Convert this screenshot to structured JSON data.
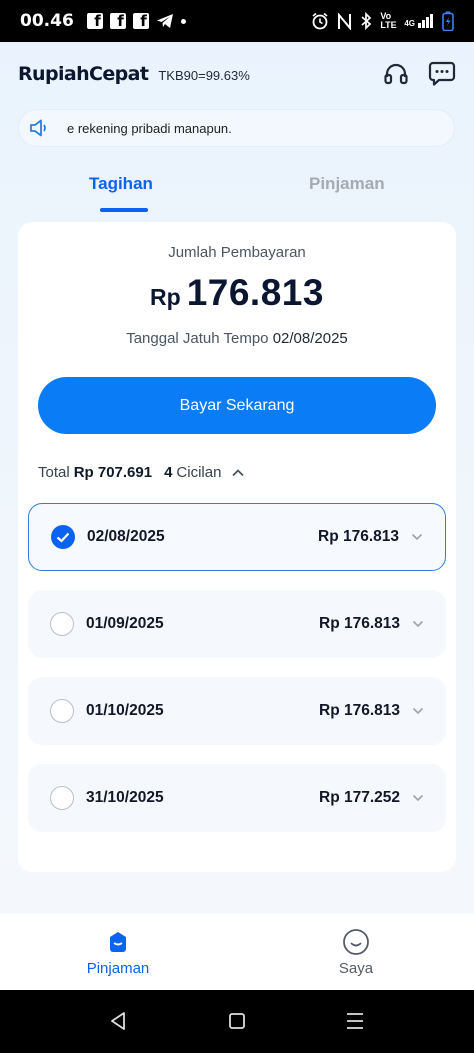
{
  "status_bar": {
    "time": "00.46",
    "left_icons": [
      "facebook-icon",
      "facebook-icon",
      "facebook-icon",
      "telegram-icon",
      "dot-icon"
    ],
    "right_icons": [
      "alarm-icon",
      "nfc-icon",
      "bluetooth-icon",
      "volte-icon",
      "signal-icon",
      "battery-icon"
    ],
    "volte_label": "Vo LTE",
    "network_label": "4G"
  },
  "header": {
    "brand": "RupiahCepat",
    "tkb": "TKB90=99.63%",
    "icons": [
      "headset-icon",
      "chat-icon"
    ]
  },
  "notice": {
    "icon": "speaker-icon",
    "text": "e rekening pribadi manapun."
  },
  "tabs": [
    {
      "label": "Tagihan",
      "active": true
    },
    {
      "label": "Pinjaman",
      "active": false
    }
  ],
  "payment": {
    "amount_label": "Jumlah Pembayaran",
    "currency": "Rp",
    "amount": "176.813",
    "due_label": "Tanggal Jatuh Tempo",
    "due_date": "02/08/2025",
    "button_label": "Bayar Sekarang"
  },
  "summary": {
    "total_label": "Total",
    "total_value": "Rp 707.691",
    "count": "4",
    "count_label": "Cicilan"
  },
  "installments": [
    {
      "date": "02/08/2025",
      "amount": "Rp 176.813",
      "selected": true
    },
    {
      "date": "01/09/2025",
      "amount": "Rp 176.813",
      "selected": false
    },
    {
      "date": "01/10/2025",
      "amount": "Rp 176.813",
      "selected": false
    },
    {
      "date": "31/10/2025",
      "amount": "Rp 177.252",
      "selected": false
    }
  ],
  "bottom_nav": [
    {
      "label": "Pinjaman",
      "icon": "loan-icon",
      "active": true
    },
    {
      "label": "Saya",
      "icon": "profile-smile-icon",
      "active": false
    }
  ],
  "colors": {
    "accent": "#0a64f0",
    "button": "#0a7cf6",
    "selected_border": "#2f7fd8"
  }
}
